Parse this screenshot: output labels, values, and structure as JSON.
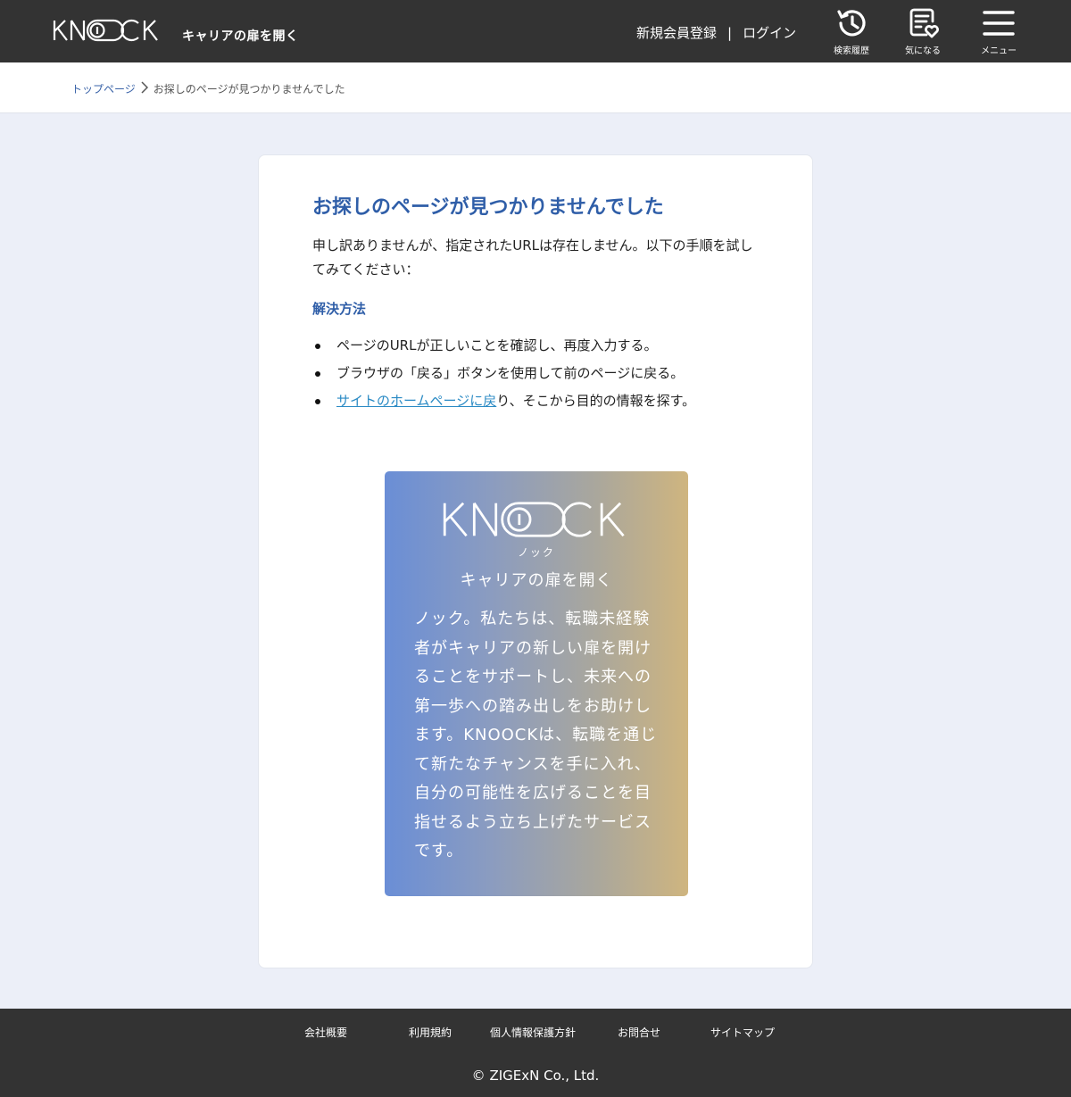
{
  "header": {
    "logo_text": "KNOOCK",
    "tagline": "キャリアの扉を開く",
    "register": "新規会員登録",
    "separator": "|",
    "login": "ログイン",
    "icons": [
      {
        "name": "history-icon",
        "label": "検索履歴"
      },
      {
        "name": "favorite-icon",
        "label": "気になる"
      },
      {
        "name": "menu-icon",
        "label": "メニュー"
      }
    ]
  },
  "breadcrumb": {
    "home": "トップページ",
    "current": "お探しのページが見つかりませんでした"
  },
  "main": {
    "title": "お探しのページが見つかりませんでした",
    "intro": "申し訳ありませんが、指定されたURLは存在しません。以下の手順を試してみてください：",
    "solutions_heading": "解決方法",
    "solutions": [
      "ページのURLが正しいことを確認し、再度入力する。",
      "ブラウザの「戻る」ボタンを使用して前のページに戻る。"
    ],
    "solution_link": "サイトのホームページに戻",
    "solution_link_rest": "り、そこから目的の情報を探す。"
  },
  "promo": {
    "logo_text": "KNOOCK",
    "kana": "ノック",
    "tagline": "キャリアの扉を開く",
    "description": "ノック。私たちは、転職未経験者がキャリアの新しい扉を開けることをサポートし、未来への第一歩への踏み出しをお助けします。KNOOCKは、転職を通じて新たなチャンスを手に入れ、自分の可能性を広げることを目指せるよう立ち上げたサービスです。",
    "gradient": [
      "#6a8ed6",
      "#cfb57f"
    ]
  },
  "footer": {
    "links": [
      "会社概要",
      "利用規約",
      "個人情報保護方針",
      "お問合せ",
      "サイトマップ"
    ],
    "copyright": "© ZIGExN Co., Ltd."
  },
  "colors": {
    "header_bg": "#333333",
    "accent_blue": "#2f5ea8",
    "link": "#2a8ac4",
    "page_bg": "#eceff8"
  }
}
